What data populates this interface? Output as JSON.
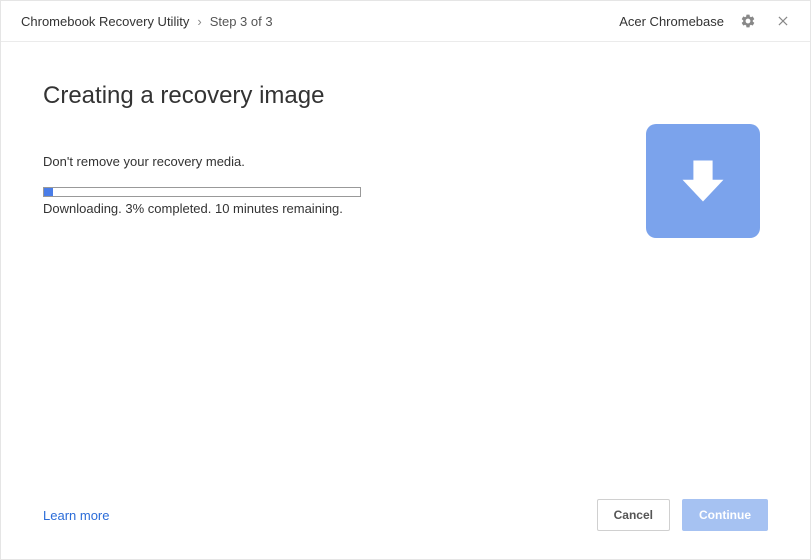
{
  "header": {
    "app_title": "Chromebook Recovery Utility",
    "separator": "›",
    "step_label": "Step 3 of 3",
    "device_name": "Acer Chromebase"
  },
  "main": {
    "title": "Creating a recovery image",
    "instruction": "Don't remove your recovery media.",
    "progress_percent": 3,
    "progress_status": "Downloading. 3% completed. 10 minutes remaining."
  },
  "footer": {
    "learn_more": "Learn more",
    "cancel": "Cancel",
    "continue": "Continue"
  },
  "colors": {
    "accent": "#7ba3ec",
    "progress": "#4a7de8",
    "link": "#2b6cd8"
  }
}
